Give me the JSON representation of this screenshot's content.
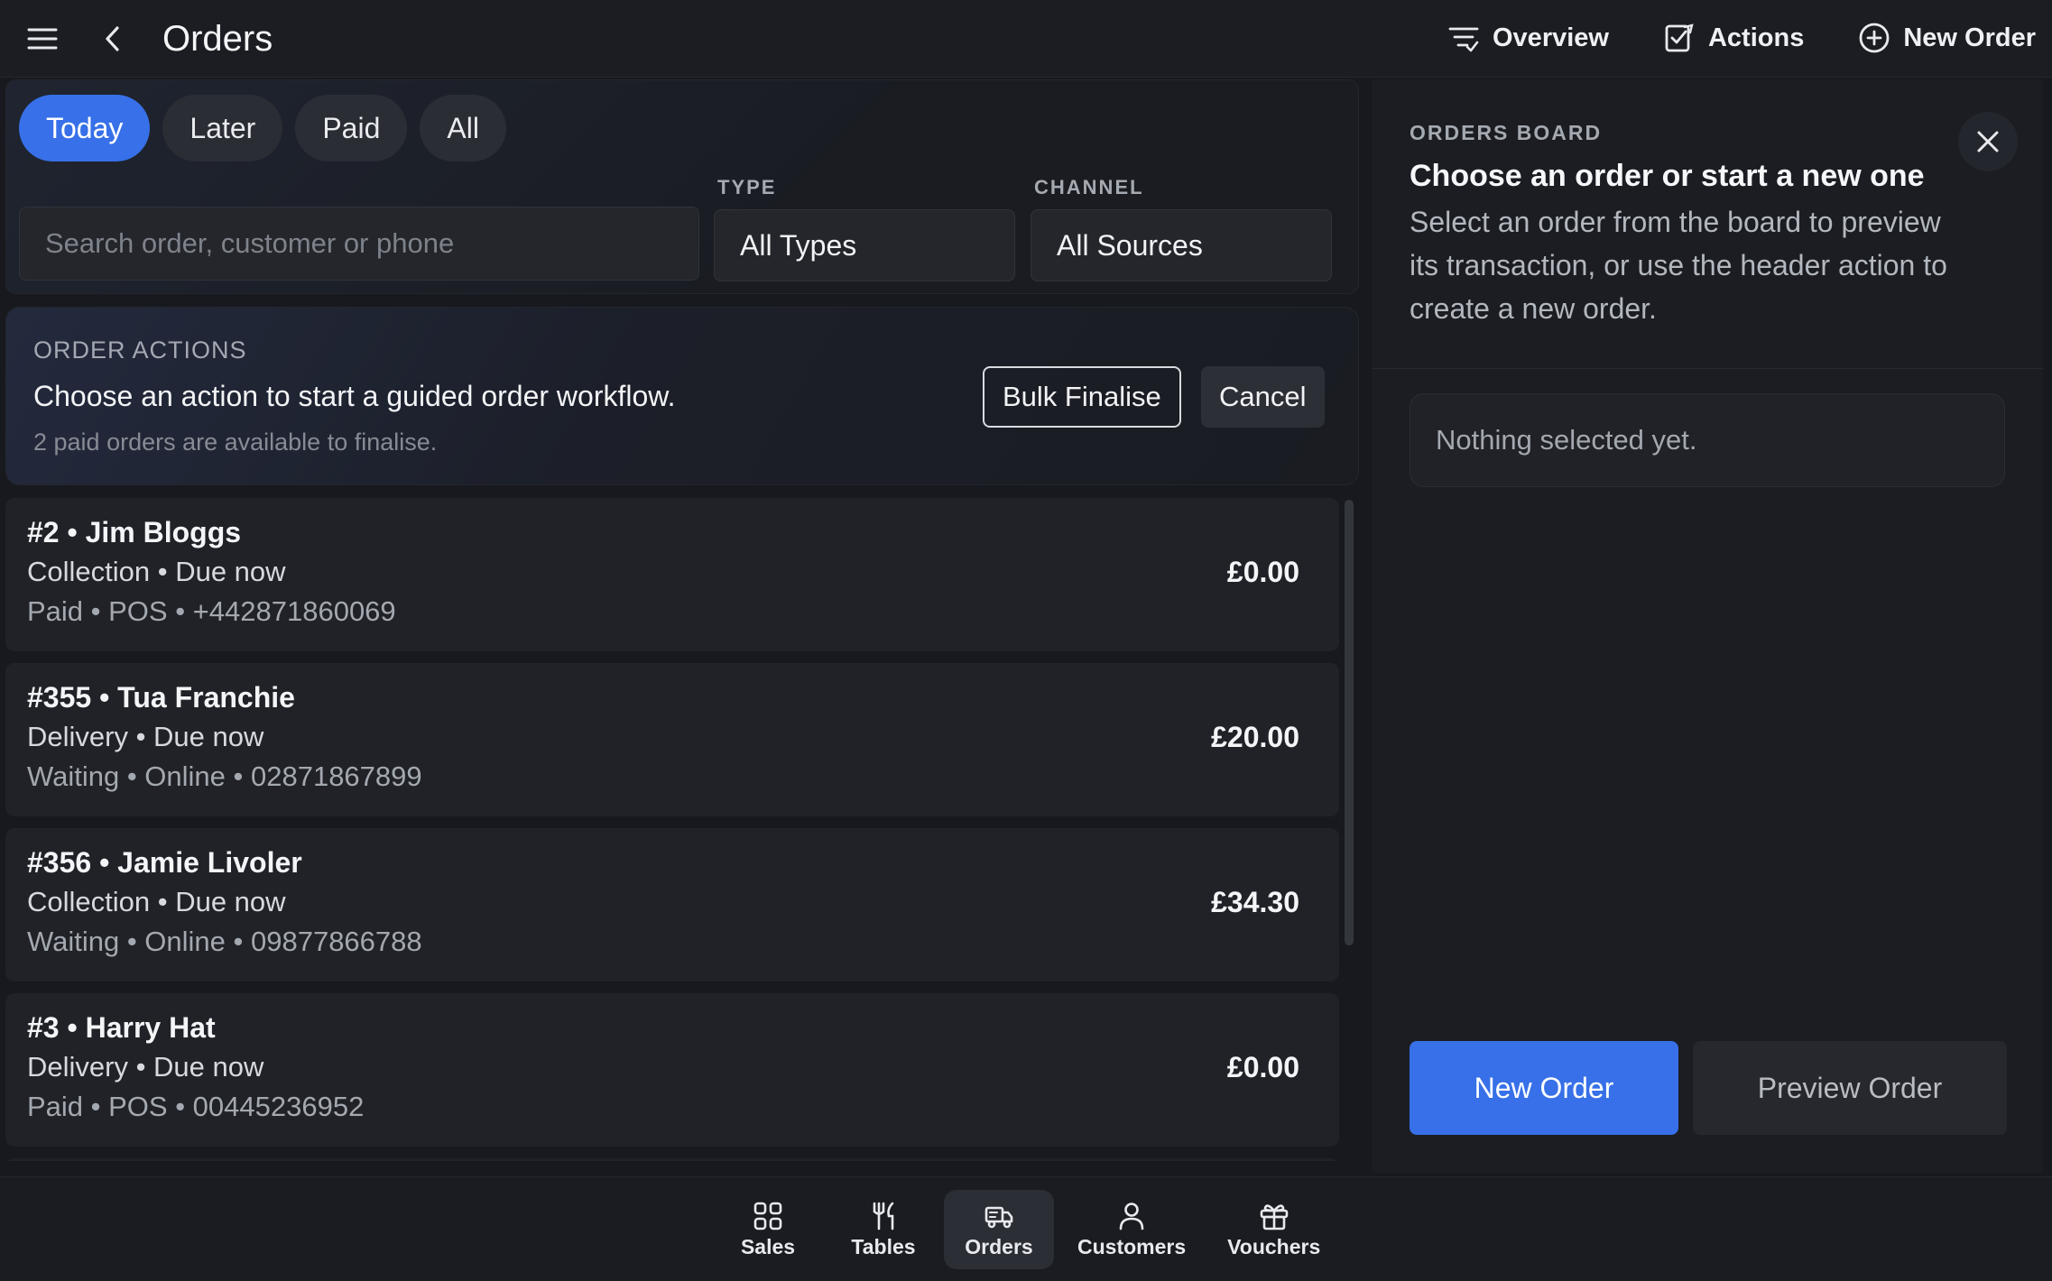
{
  "header": {
    "title": "Orders",
    "actions": [
      {
        "label": "Overview",
        "icon": "filter-lines-icon"
      },
      {
        "label": "Actions",
        "icon": "edit-square-icon"
      },
      {
        "label": "New Order",
        "icon": "plus-circle-icon"
      }
    ]
  },
  "filters": {
    "chips": [
      {
        "label": "Today",
        "active": true
      },
      {
        "label": "Later",
        "active": false
      },
      {
        "label": "Paid",
        "active": false
      },
      {
        "label": "All",
        "active": false
      }
    ],
    "search_placeholder": "Search order, customer or phone",
    "type_label": "TYPE",
    "type_value": "All Types",
    "channel_label": "CHANNEL",
    "channel_value": "All Sources"
  },
  "order_actions": {
    "eyebrow": "ORDER ACTIONS",
    "heading": "Choose an action to start a guided order workflow.",
    "sub": "2 paid orders are available to finalise.",
    "bulk_label": "Bulk Finalise",
    "cancel_label": "Cancel"
  },
  "orders": [
    {
      "title": "#2 • Jim Bloggs",
      "line1": "Collection • Due now",
      "line2": "Paid • POS • +442871860069",
      "amount": "£0.00"
    },
    {
      "title": "#355 • Tua Franchie",
      "line1": "Delivery • Due now",
      "line2": "Waiting • Online • 02871867899",
      "amount": "£20.00"
    },
    {
      "title": "#356 • Jamie Livoler",
      "line1": "Collection • Due now",
      "line2": "Waiting • Online • 09877866788",
      "amount": "£34.30"
    },
    {
      "title": "#3 • Harry Hat",
      "line1": "Delivery • Due now",
      "line2": "Paid • POS • 00445236952",
      "amount": "£0.00"
    }
  ],
  "board": {
    "eyebrow": "ORDERS BOARD",
    "title": "Choose an order or start a new one",
    "description": "Select an order from the board to preview its transaction, or use the header action to create a new order.",
    "empty": "Nothing selected yet.",
    "new_order_label": "New Order",
    "preview_label": "Preview Order"
  },
  "nav": [
    {
      "label": "Sales",
      "icon": "grid-icon",
      "active": false
    },
    {
      "label": "Tables",
      "icon": "utensils-icon",
      "active": false
    },
    {
      "label": "Orders",
      "icon": "delivery-truck-icon",
      "active": true
    },
    {
      "label": "Customers",
      "icon": "person-icon",
      "active": false
    },
    {
      "label": "Vouchers",
      "icon": "gift-icon",
      "active": false
    }
  ],
  "colors": {
    "accent": "#3770e8",
    "background": "#17191e",
    "card": "#202227"
  }
}
